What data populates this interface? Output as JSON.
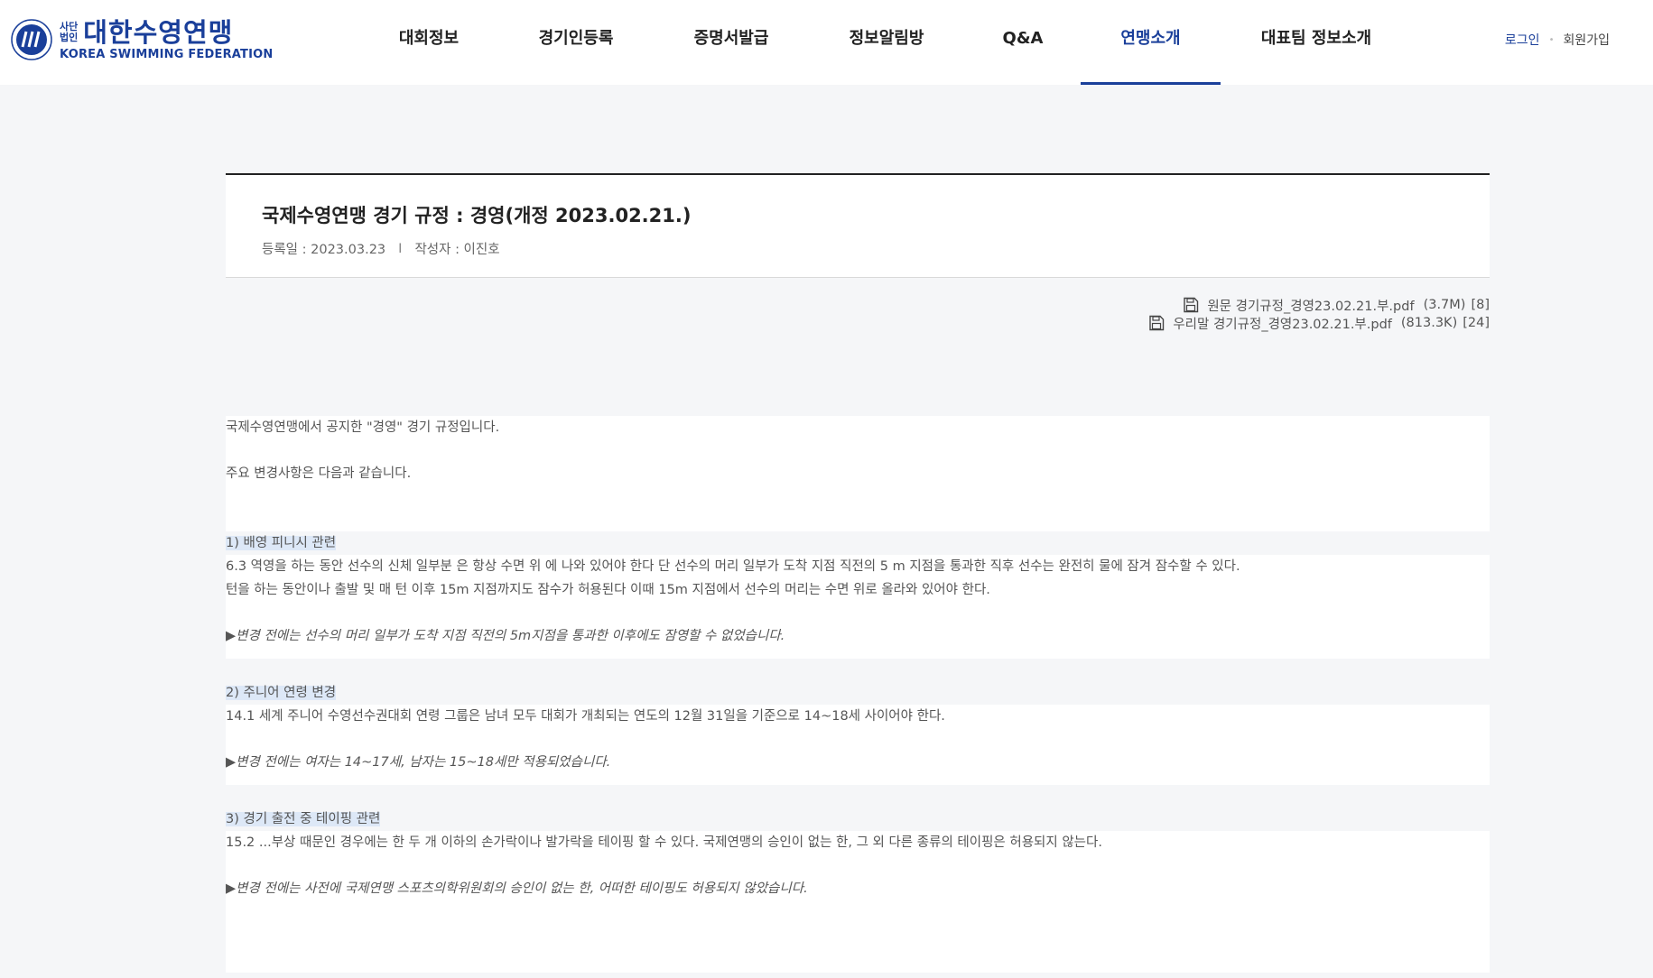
{
  "header": {
    "logo": {
      "corp_line1": "사단",
      "corp_line2": "법인",
      "name_ko": "대한수영연맹",
      "name_en": "KOREA SWIMMING FEDERATION"
    },
    "nav": [
      {
        "label": "대회정보"
      },
      {
        "label": "경기인등록"
      },
      {
        "label": "증명서발급"
      },
      {
        "label": "정보알림방"
      },
      {
        "label": "Q&A"
      },
      {
        "label": "연맹소개"
      },
      {
        "label": "대표팀 정보소개"
      }
    ],
    "active_nav": "연맹소개",
    "auth": {
      "login": "로그인",
      "signup": "회원가입"
    }
  },
  "post": {
    "title": "국제수영연맹 경기 규정 : 경영(개정 2023.02.21.)",
    "date": "등록일 : 2023.03.23",
    "divider": "I",
    "author": "작성자 : 이진호"
  },
  "attachments": [
    {
      "name": "원문 경기규정_경영23.02.21.부.pdf",
      "size": "(3.7M)",
      "count": "[8]",
      "icon": "save-file-icon"
    },
    {
      "name": "우리말 경기규정_경영23.02.21.부.pdf",
      "size": "(813.3K)",
      "count": "[24]",
      "icon": "save-file-icon"
    }
  ],
  "article": {
    "intro": "국제수영연맹에서 공지한 \"경영\" 경기 규정입니다.",
    "summary": "주요 변경사항은 다음과 같습니다.",
    "sections": [
      {
        "heading": "1) 배영 피니시 관련",
        "lines": [
          "6.3 역영을 하는 동안 선수의 신체 일부분 은 항상 수면 위 에 나와 있어야 한다 단 선수의 머리 일부가 도착 지점 직전의 5 m 지점을 통과한 직후 선수는 완전히 물에 잠겨 잠수할 수 있다.",
          "턴을 하는 동안이나 출발 및 매 턴 이후 15m 지점까지도 잠수가 허용된다 이때 15m 지점에서 선수의 머리는 수면 위로 올라와 있어야 한다."
        ],
        "note": "▶변경 전에는 선수의 머리 일부가 도착 지점 직전의 5m지점을 통과한 이후에도 잠영할 수 없었습니다."
      },
      {
        "heading": "2) 주니어 연령 변경",
        "lines": [
          "14.1 세계 주니어 수영선수권대회 연령 그룹은 남녀 모두 대회가 개최되는 연도의 12월 31일을 기준으로 14~18세 사이어야 한다."
        ],
        "note": "▶변경 전에는 여자는 14~17세, 남자는 15~18세만 적용되었습니다."
      },
      {
        "heading": "3) 경기 출전 중 테이핑 관련",
        "lines": [
          "15.2 ...부상 때문인 경우에는 한 두 개 이하의 손가락이나 발가락을 테이핑 할 수 있다. 국제연맹의 승인이 없는 한, 그 외 다른 종류의 테이핑은 허용되지 않는다."
        ],
        "note": "▶변경 전에는 사전에 국제연맹 스포츠의학위원회의 승인이 없는 한, 어떠한 테이핑도 허용되지 않았습니다."
      }
    ]
  },
  "colors": {
    "brand": "#1a3f9a",
    "highlight": "#dde8f7",
    "page_bg": "#f5f6f8"
  }
}
